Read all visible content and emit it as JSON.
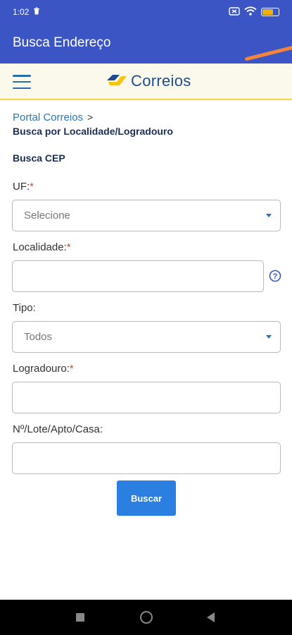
{
  "status_bar": {
    "time": "1:02",
    "battery_level_percent": 70
  },
  "app_bar": {
    "title": "Busca Endereço"
  },
  "header": {
    "logo_text": "Correios"
  },
  "breadcrumb": {
    "link": "Portal Correios",
    "separator": ">",
    "current": "Busca por Localidade/Logradouro"
  },
  "form": {
    "section_title": "Busca CEP",
    "uf": {
      "label": "UF:",
      "required_mark": "*",
      "value": "Selecione"
    },
    "localidade": {
      "label": "Localidade:",
      "required_mark": "*",
      "value": ""
    },
    "tipo": {
      "label": "Tipo:",
      "value": "Todos"
    },
    "logradouro": {
      "label": "Logradouro:",
      "required_mark": "*",
      "value": ""
    },
    "numero": {
      "label": "Nº/Lote/Apto/Casa:",
      "value": ""
    },
    "submit_label": "Buscar"
  },
  "colors": {
    "app_bar": "#3b55c4",
    "header_bg": "#fbf9ec",
    "header_border": "#f6d44a",
    "accent": "#f2843d",
    "button": "#2a7fe0",
    "link": "#2e78b5",
    "required": "#e0442b"
  }
}
